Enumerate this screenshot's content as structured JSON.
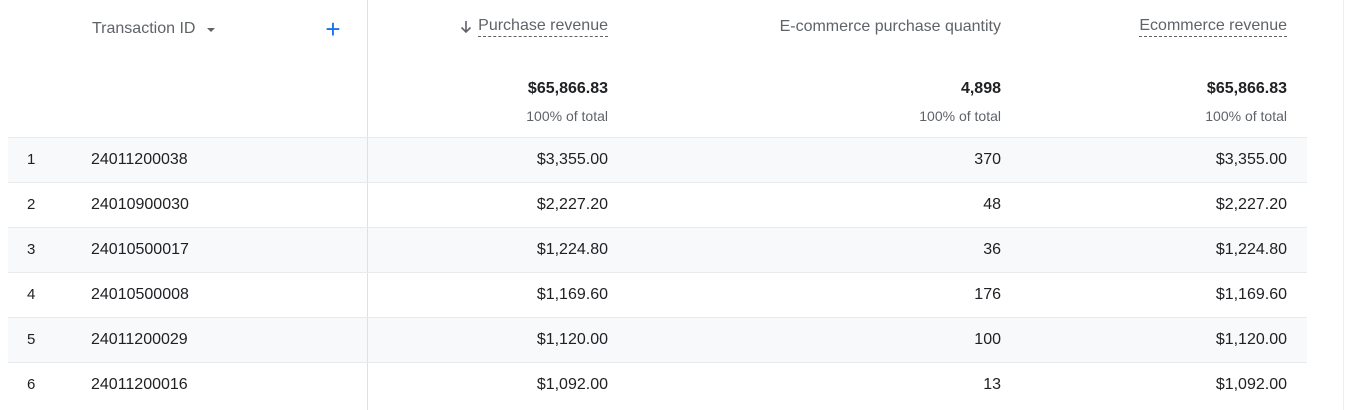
{
  "header": {
    "dimension_label": "Transaction ID",
    "add_dimension_symbol": "+",
    "columns": [
      {
        "label": "Purchase revenue",
        "sorted": "descending",
        "dashed": true
      },
      {
        "label": "E-commerce purchase quantity",
        "sorted": "",
        "dashed": false
      },
      {
        "label": "Ecommerce revenue",
        "sorted": "",
        "dashed": true
      }
    ]
  },
  "totals": {
    "purchase_revenue": "$65,866.83",
    "purchase_revenue_pct": "100% of total",
    "purchase_quantity": "4,898",
    "purchase_quantity_pct": "100% of total",
    "ecommerce_revenue": "$65,866.83",
    "ecommerce_revenue_pct": "100% of total"
  },
  "rows": [
    {
      "index": "1",
      "transaction_id": "24011200038",
      "purchase_revenue": "$3,355.00",
      "quantity": "370",
      "ecommerce_revenue": "$3,355.00"
    },
    {
      "index": "2",
      "transaction_id": "24010900030",
      "purchase_revenue": "$2,227.20",
      "quantity": "48",
      "ecommerce_revenue": "$2,227.20"
    },
    {
      "index": "3",
      "transaction_id": "24010500017",
      "purchase_revenue": "$1,224.80",
      "quantity": "36",
      "ecommerce_revenue": "$1,224.80"
    },
    {
      "index": "4",
      "transaction_id": "24010500008",
      "purchase_revenue": "$1,169.60",
      "quantity": "176",
      "ecommerce_revenue": "$1,169.60"
    },
    {
      "index": "5",
      "transaction_id": "24011200029",
      "purchase_revenue": "$1,120.00",
      "quantity": "100",
      "ecommerce_revenue": "$1,120.00"
    },
    {
      "index": "6",
      "transaction_id": "24011200016",
      "purchase_revenue": "$1,092.00",
      "quantity": "13",
      "ecommerce_revenue": "$1,092.00"
    }
  ],
  "colors": {
    "accent": "#1a73e8",
    "text": "#202124",
    "muted": "#5f6368",
    "row_alt": "#f8f9fa",
    "border": "#e0e0e0"
  },
  "icons": {
    "sort": "arrow-down-icon",
    "dropdown": "caret-down-icon",
    "add": "plus-icon"
  }
}
